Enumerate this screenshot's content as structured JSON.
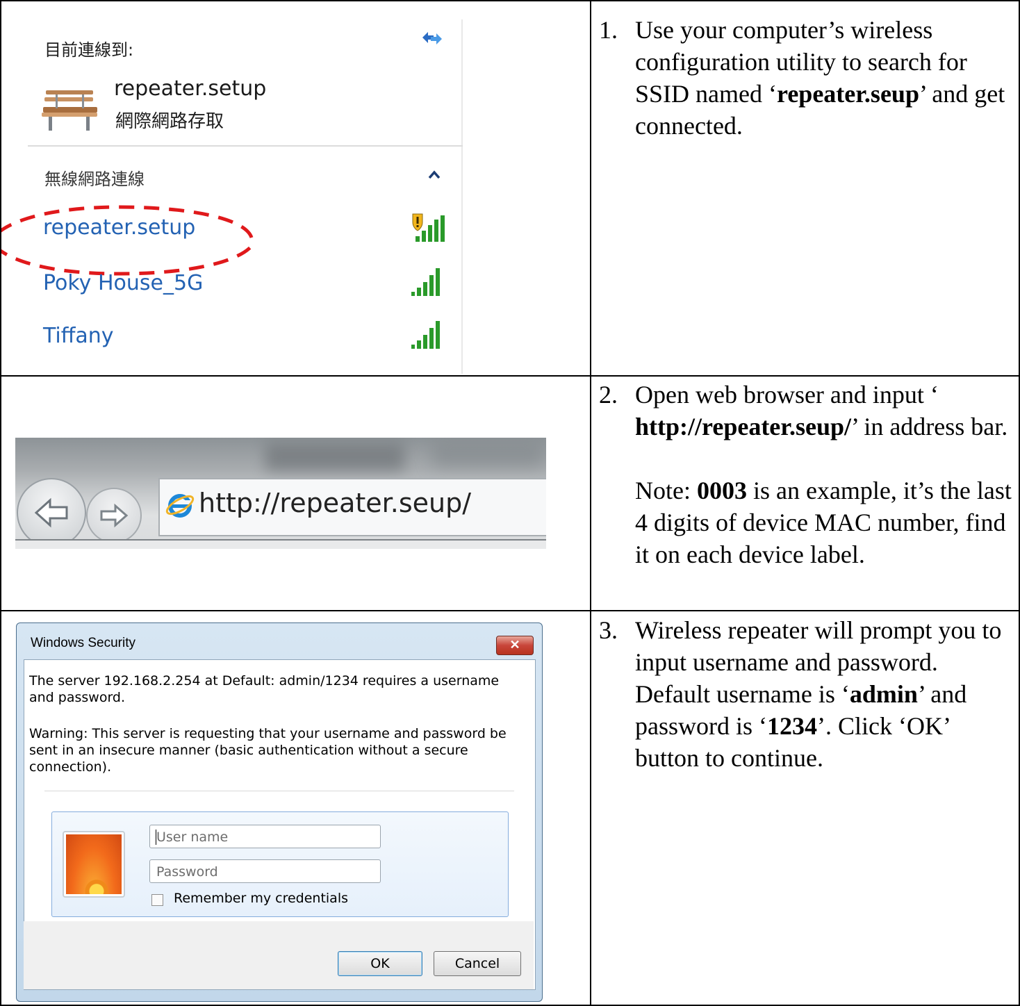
{
  "wifi_panel": {
    "connected_label": "目前連線到:",
    "current_network_name": "repeater.setup",
    "current_network_status": "網際網路存取",
    "section_label": "無線網路連線",
    "networks": [
      {
        "name": "repeater.setup",
        "signal_bars": 5,
        "secured_warning": true
      },
      {
        "name": "Poky House_5G",
        "signal_bars": 5,
        "secured_warning": false
      },
      {
        "name": "Tiffany",
        "signal_bars": 5,
        "secured_warning": false
      }
    ],
    "colors": {
      "network_link": "#2362b3",
      "highlight": "#e0191b",
      "signal": "#2a9a2a"
    }
  },
  "browser": {
    "url": "http://repeater.seup/"
  },
  "dialog": {
    "title": "Windows Security",
    "close_glyph": "✕",
    "message": "The server 192.168.2.254 at Default: admin/1234 requires a username and password.",
    "warning": "Warning: This server is requesting that your username and password be sent in an insecure manner (basic authentication without a secure connection).",
    "username_placeholder": "User name",
    "password_placeholder": "Password",
    "remember_label": "Remember my credentials",
    "ok_label": "OK",
    "cancel_label": "Cancel"
  },
  "steps": {
    "s1": {
      "num": "1.",
      "t1": "Use your computer’s wireless configuration utility to search for SSID named ‘",
      "b1": "repeater.seup",
      "t2": "’ and get connected."
    },
    "s2": {
      "num": "2.",
      "t1": "Open web browser and input ‘ ",
      "b1": "http://repeater.seup/",
      "t2": "’ in address bar.",
      "note_prefix": "Note: ",
      "note_bold": "0003",
      "note_rest": " is an example, it’s the last 4 digits of device MAC number, find it on each device label."
    },
    "s3": {
      "num": "3.",
      "t1": "Wireless repeater will prompt you to input username and password. Default username is ‘",
      "b1": "admin",
      "t2": "’ and password is ‘",
      "b2": "1234",
      "t3": "’. Click ‘OK’ button to continue."
    }
  }
}
